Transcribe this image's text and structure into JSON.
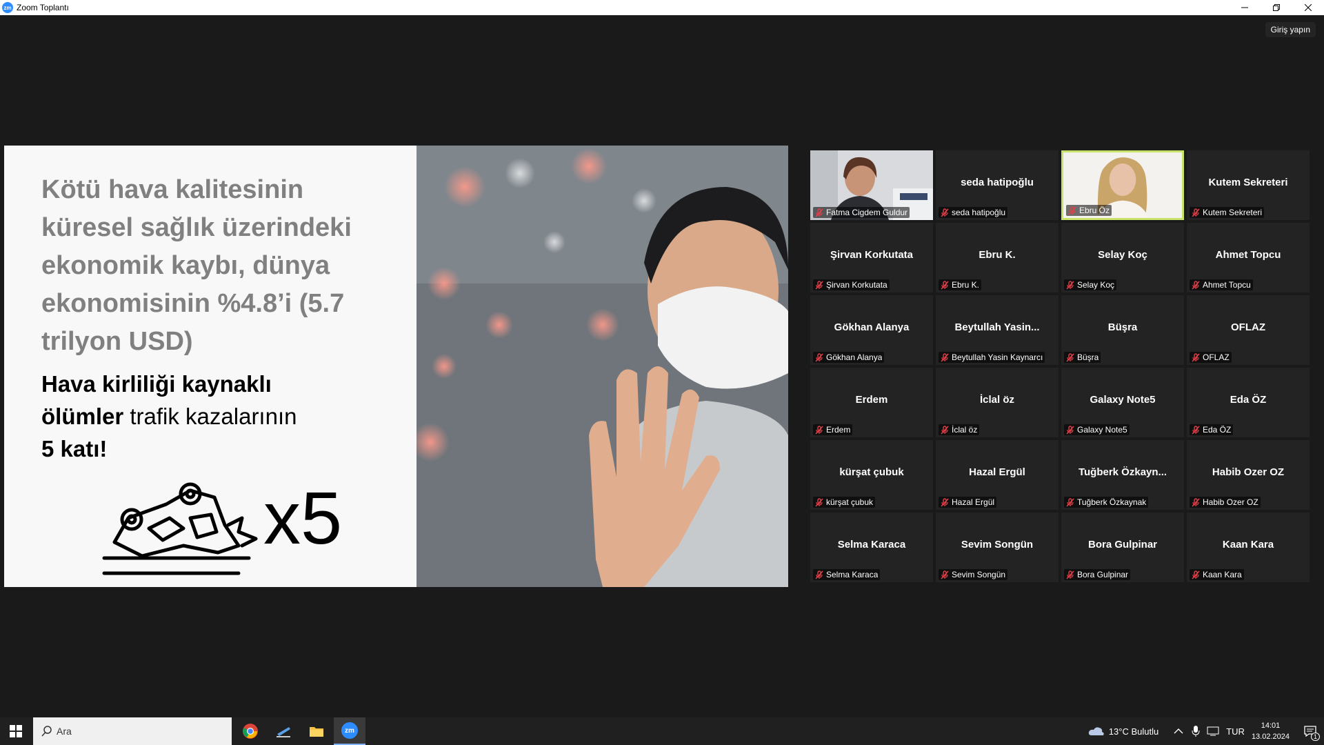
{
  "window": {
    "title": "Zoom Toplantı",
    "app_icon_text": "zm",
    "controls": [
      "minimize",
      "restore",
      "close"
    ]
  },
  "signin_label": "Giriş yapın",
  "slide": {
    "title": "Kötü hava kalitesinin küresel sağlık üzerindeki ekonomik kaybı, dünya ekonomisinin %4.8’i (5.7 trilyon USD)",
    "subtitle_bold1": "Hava kirliliği kaynaklı",
    "subtitle_bold2": "ölümler",
    "subtitle_regular": " trafik kazalarının",
    "subtitle_bold3": "5 katı!",
    "multiplier": "x5",
    "icon": "overturned-car-icon"
  },
  "participants": [
    {
      "display": "",
      "label": "Fatma Cigdem Guldur",
      "video": true
    },
    {
      "display": "seda hatipoğlu",
      "label": "seda hatipoğlu",
      "video": false
    },
    {
      "display": "",
      "label": "Ebru Öz",
      "video": true,
      "active_speaker": true
    },
    {
      "display": "Kutem Sekreteri",
      "label": "Kutem Sekreteri",
      "video": false
    },
    {
      "display": "Şirvan Korkutata",
      "label": "Şirvan Korkutata",
      "video": false
    },
    {
      "display": "Ebru K.",
      "label": "Ebru K.",
      "video": false
    },
    {
      "display": "Selay Koç",
      "label": "Selay Koç",
      "video": false
    },
    {
      "display": "Ahmet Topcu",
      "label": "Ahmet Topcu",
      "video": false
    },
    {
      "display": "Gökhan Alanya",
      "label": "Gökhan Alanya",
      "video": false
    },
    {
      "display": "Beytullah  Yasin...",
      "label": "Beytullah Yasin Kaynarcı",
      "video": false
    },
    {
      "display": "Büşra",
      "label": "Büşra",
      "video": false
    },
    {
      "display": "OFLAZ",
      "label": "OFLAZ",
      "video": false
    },
    {
      "display": "Erdem",
      "label": "Erdem",
      "video": false
    },
    {
      "display": "İclal öz",
      "label": "İclal öz",
      "video": false
    },
    {
      "display": "Galaxy Note5",
      "label": "Galaxy Note5",
      "video": false
    },
    {
      "display": "Eda ÖZ",
      "label": "Eda ÖZ",
      "video": false
    },
    {
      "display": "kürşat çubuk",
      "label": "kürşat çubuk",
      "video": false
    },
    {
      "display": "Hazal Ergül",
      "label": "Hazal Ergül",
      "video": false
    },
    {
      "display": "Tuğberk  Özkayn...",
      "label": "Tuğberk Özkaynak",
      "video": false
    },
    {
      "display": "Habib Ozer OZ",
      "label": "Habib Ozer OZ",
      "video": false
    },
    {
      "display": "Selma Karaca",
      "label": "Selma Karaca",
      "video": false
    },
    {
      "display": "Sevim Songün",
      "label": "Sevim Songün",
      "video": false
    },
    {
      "display": "Bora Gulpinar",
      "label": "Bora Gulpinar",
      "video": false
    },
    {
      "display": "Kaan Kara",
      "label": "Kaan Kara",
      "video": false
    }
  ],
  "taskbar": {
    "search_placeholder": "Ara",
    "apps": [
      "chrome-icon",
      "presentation-icon",
      "file-explorer-icon",
      "zoom-icon"
    ],
    "zoom_icon_text": "zm",
    "weather": "13°C  Bulutlu",
    "language": "TUR",
    "time": "14:01",
    "date": "13.02.2024",
    "notification_count": "1"
  },
  "colors": {
    "accent_active_speaker": "#c8e26a",
    "mute_red": "#e0404a",
    "background": "#1a1a1a",
    "tile": "#232323"
  }
}
